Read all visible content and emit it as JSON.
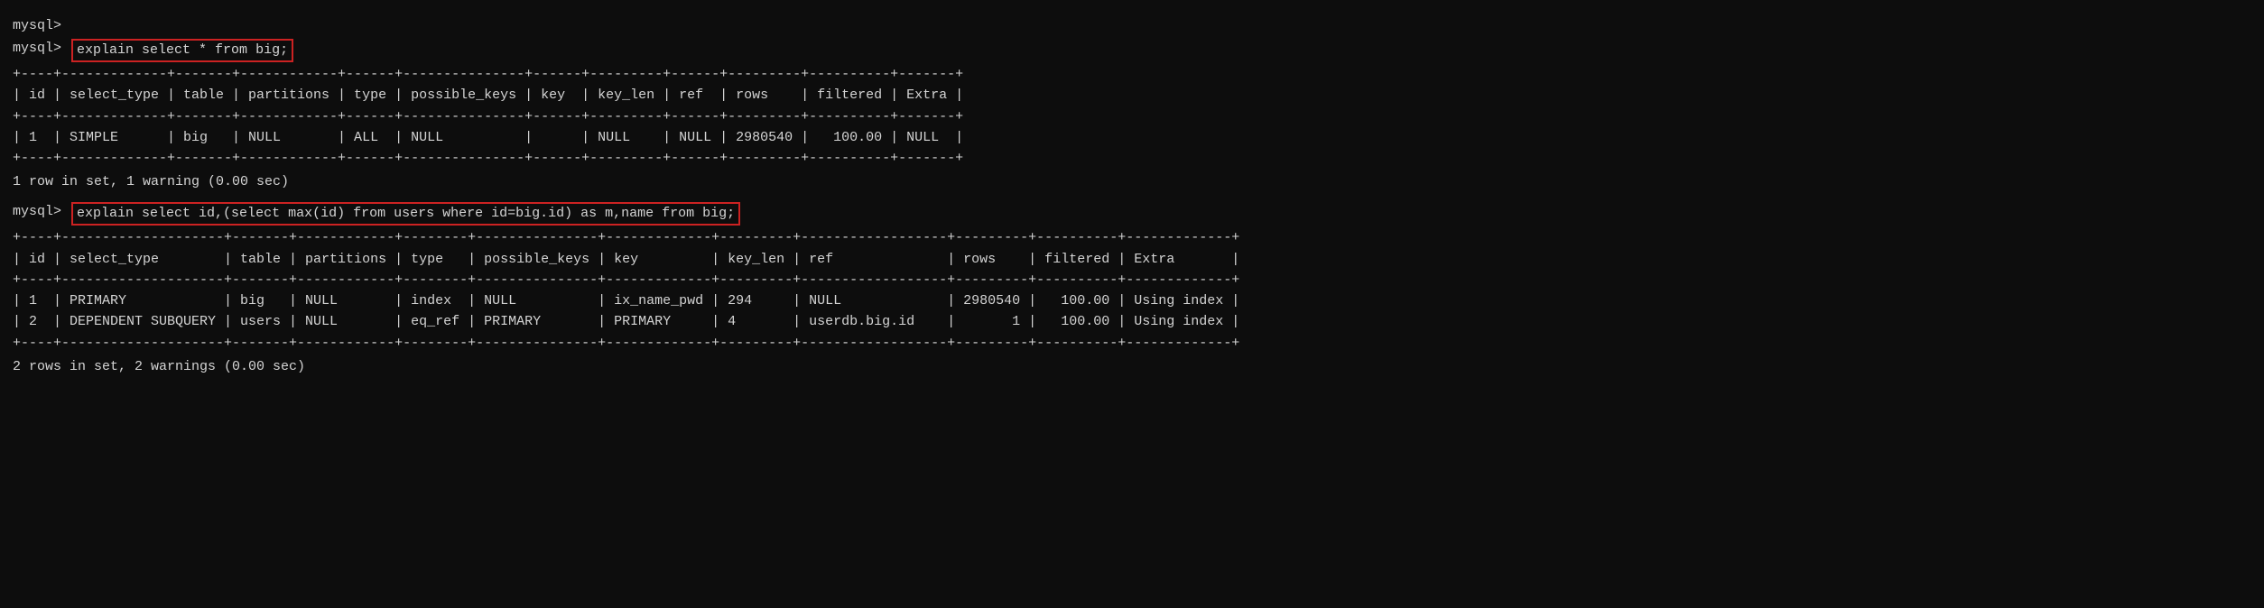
{
  "terminal": {
    "empty_prompt": "mysql>",
    "command1": {
      "prompt": "mysql>",
      "command": "explain select * from big;"
    },
    "table1": {
      "separator": "+----+-------------+-------+------------+------+---------------+------+---------+------+---------+----------+-------+",
      "header": "| id | select_type | table | partitions | type | possible_keys | key  | key_len | ref  | rows    | filtered | Extra |",
      "row": "| 1  | SIMPLE      | big   | NULL       | ALL  | NULL          |      | NULL    | NULL | 2980540 |   100.00 | NULL  |"
    },
    "result1": "1 row in set, 1 warning (0.00 sec)",
    "command2": {
      "prompt": "mysql>",
      "command": "explain select id,(select max(id) from users where id=big.id) as m,name from big;"
    },
    "table2": {
      "separator_top": "+----+--------------------+-------+------------+--------+---------------+-------------+---------+------------------+---------+----------+-------------+",
      "header": "| id | select_type        | table | partitions | type   | possible_keys | key         | key_len | ref              | rows    | filtered | Extra       |",
      "separator_mid": "+----+--------------------+-------+------------+--------+---------------+-------------+---------+------------------+---------+----------+-------------+",
      "row1": "| 1  | PRIMARY            | big   | NULL       | index  | NULL          | ix_name_pwd | 294     | NULL             | 2980540 |   100.00 | Using index |",
      "row2": "| 2  | DEPENDENT SUBQUERY | users | NULL       | eq_ref | PRIMARY       | PRIMARY     | 4       | userdb.big.id    |       1 |   100.00 | Using index |",
      "separator_bot": "+----+--------------------+-------+------------+--------+---------------+-------------+---------+------------------+---------+----------+-------------+"
    },
    "result2": "2 rows in set, 2 warnings (0.00 sec)"
  }
}
